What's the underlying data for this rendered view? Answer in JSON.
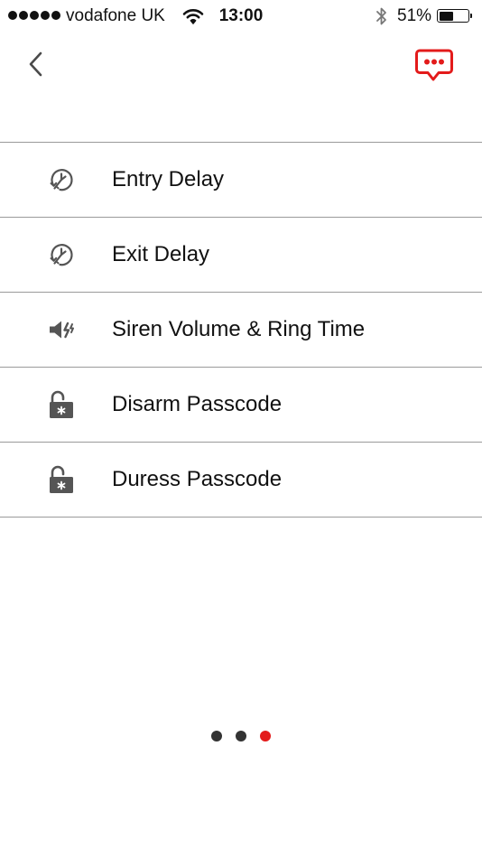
{
  "status_bar": {
    "carrier": "vodafone UK",
    "time": "13:00",
    "battery_percent_label": "51%",
    "battery_level": 0.51,
    "signal_bars": 5,
    "icons": [
      "wifi-icon",
      "bluetooth-icon",
      "battery-icon"
    ]
  },
  "nav": {
    "back_icon": "chevron-left-icon",
    "chat_icon": "chat-bubble-icon"
  },
  "settings": {
    "items": [
      {
        "label": "Entry Delay",
        "icon": "clock-key-icon"
      },
      {
        "label": "Exit Delay",
        "icon": "clock-key-icon"
      },
      {
        "label": "Siren Volume & Ring Time",
        "icon": "speaker-icon"
      },
      {
        "label": "Disarm Passcode",
        "icon": "padlock-open-icon"
      },
      {
        "label": "Duress Passcode",
        "icon": "padlock-open-icon"
      }
    ]
  },
  "pager": {
    "total": 3,
    "active_index": 2
  },
  "colors": {
    "accent": "#e31b1b",
    "icon_gray": "#555555",
    "text": "#111111",
    "divider": "#9a9a9a",
    "dot_inactive": "#333333"
  }
}
